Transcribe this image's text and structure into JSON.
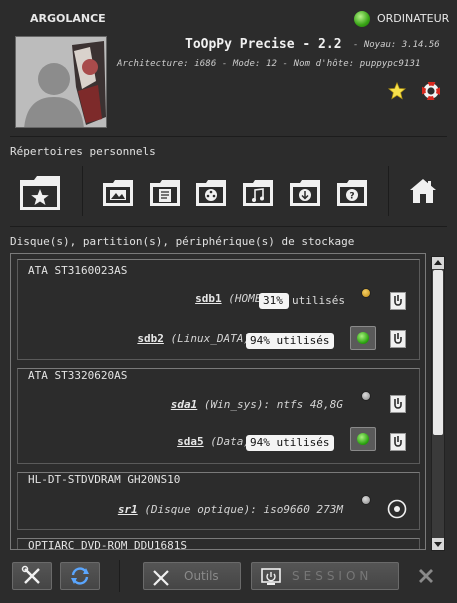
{
  "header": {
    "username": "ARGOLANCE",
    "status_label": "ORDINATEUR",
    "distro_title": "ToOpPy Precise - 2.2",
    "kernel": "- Noyau: 3.14.56",
    "arch_line": "Architecture: i686 - Mode: 12 - Nom d'hôte: puppypc9131"
  },
  "personal": {
    "title": "Répertoires personnels",
    "icons": [
      "favorites-folder-icon",
      "pictures-folder-icon",
      "documents-folder-icon",
      "videos-folder-icon",
      "music-folder-icon",
      "downloads-folder-icon",
      "misc-folder-icon",
      "home-icon"
    ]
  },
  "storage": {
    "title": "Disque(s), partition(s), périphérique(s) de stockage",
    "groups": [
      {
        "label": "ATA ST3160023AS",
        "rows": [
          {
            "device": "sdb1",
            "sub": "(HOME)",
            "usage": "31%",
            "usage_rest": "utilisés",
            "led": "amber"
          },
          {
            "device": "sdb2",
            "sub": "(Linux_DATA)",
            "usage": "94% utilisés",
            "led": "mounted"
          }
        ]
      },
      {
        "label": "ATA ST3320620AS",
        "rows": [
          {
            "device": "sda1",
            "sub": "(Win_sys): ntfs 48,8G",
            "led": "grey"
          },
          {
            "device": "sda5",
            "sub": "(Data)",
            "usage": "94% utilisés",
            "led": "mounted"
          }
        ]
      },
      {
        "label": "HL-DT-STDVDRAM GH20NS10",
        "rows": [
          {
            "device": "sr1",
            "sub": "(Disque optique): iso9660 273M",
            "led": "grey"
          }
        ]
      },
      {
        "label": "OPTIARC DVD-ROM DDU1681S"
      }
    ]
  },
  "toolbar": {
    "tools_label": "Outils",
    "session_label": "SESSION"
  },
  "colors": {
    "accent_green": "#37a315",
    "led_amber": "#c08a12",
    "background": "#2c2c2c"
  }
}
